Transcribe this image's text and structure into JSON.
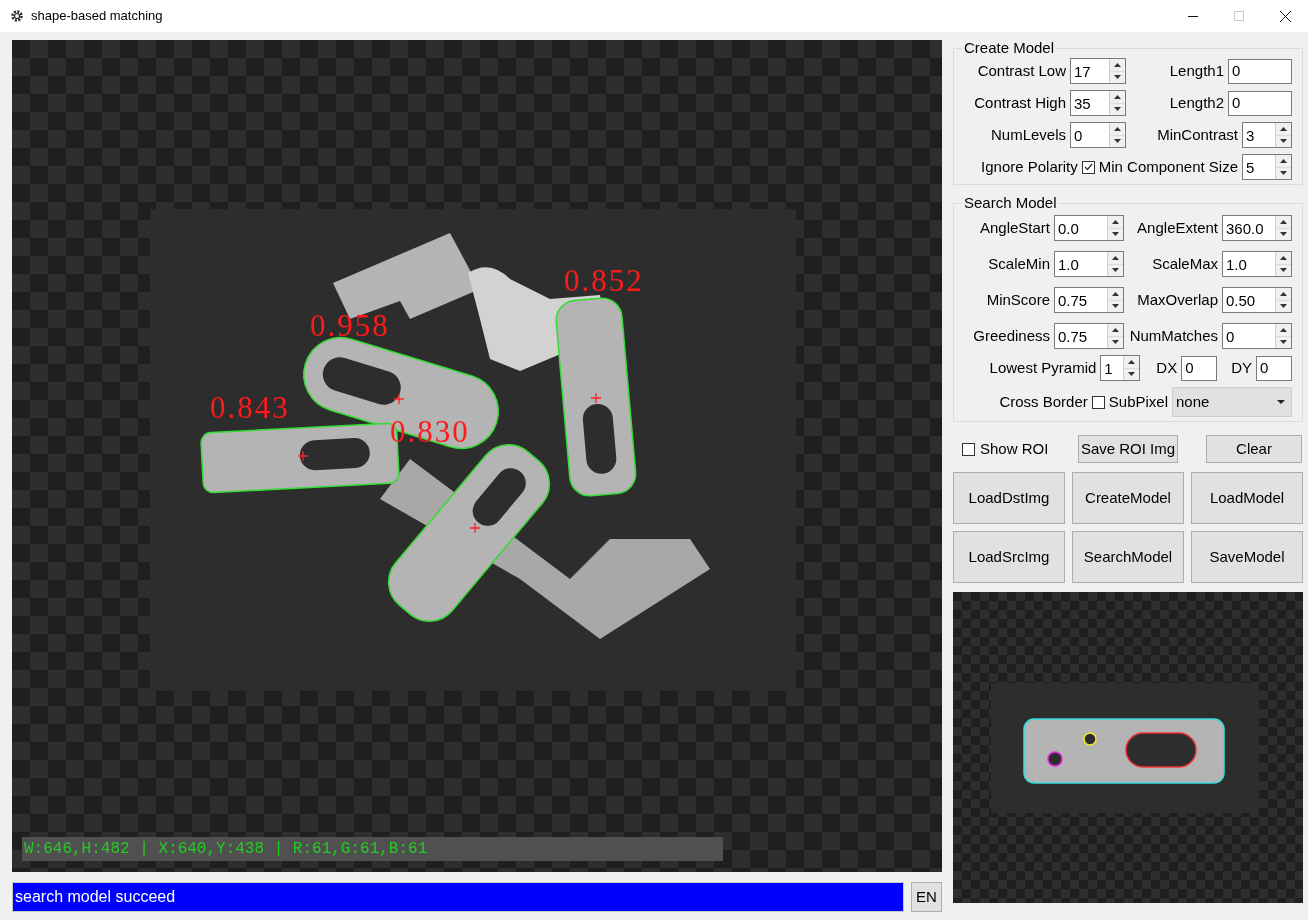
{
  "window": {
    "title": "shape-based matching",
    "controls": [
      {
        "kind": "minimize",
        "disabled": false
      },
      {
        "kind": "maximize",
        "disabled": true
      },
      {
        "kind": "close",
        "disabled": false
      }
    ]
  },
  "viewer": {
    "matches": [
      {
        "score": "0.852"
      },
      {
        "score": "0.958"
      },
      {
        "score": "0.843"
      },
      {
        "score": "0.830"
      }
    ],
    "info": "W:646,H:482 | X:640,Y:438 | R:61,G:61,B:61"
  },
  "status": {
    "message": "search model succeed",
    "language": "EN"
  },
  "create_model": {
    "title": "Create Model",
    "fields": [
      {
        "label": "Contrast Low",
        "value": "17",
        "kind": "spin"
      },
      {
        "label": "Length1",
        "value": "0",
        "kind": "text"
      },
      {
        "label": "Contrast High",
        "value": "35",
        "kind": "spin"
      },
      {
        "label": "Length2",
        "value": "0",
        "kind": "text"
      },
      {
        "label": "NumLevels",
        "value": "0",
        "kind": "spin"
      },
      {
        "label": "MinContrast",
        "value": "3",
        "kind": "spin"
      }
    ],
    "ignore_polarity": {
      "label": "Ignore Polarity",
      "checked": true
    },
    "min_component_size": {
      "label": "Min Component Size",
      "value": "5"
    }
  },
  "search_model": {
    "title": "Search Model",
    "fields": [
      {
        "label": "AngleStart",
        "value": "0.0"
      },
      {
        "label": "AngleExtent",
        "value": "360.0"
      },
      {
        "label": "ScaleMin",
        "value": "1.0"
      },
      {
        "label": "ScaleMax",
        "value": "1.0"
      },
      {
        "label": "MinScore",
        "value": "0.75"
      },
      {
        "label": "MaxOverlap",
        "value": "0.50"
      },
      {
        "label": "Greediness",
        "value": "0.75"
      },
      {
        "label": "NumMatches",
        "value": "0"
      }
    ],
    "lowest_pyramid": {
      "label": "Lowest Pyramid",
      "value": "1"
    },
    "dx": {
      "label": "DX",
      "value": "0"
    },
    "dy": {
      "label": "DY",
      "value": "0"
    },
    "cross_border": {
      "label": "Cross Border",
      "checked": false
    },
    "subpixel": {
      "label": "SubPixel",
      "value": "none"
    }
  },
  "show_roi": {
    "label": "Show ROI",
    "checked": false
  },
  "tool_buttons": [
    "Save ROI Img",
    "Clear"
  ],
  "actions": [
    "LoadDstImg",
    "CreateModel",
    "LoadModel",
    "LoadSrcImg",
    "SearchModel",
    "SaveModel"
  ]
}
